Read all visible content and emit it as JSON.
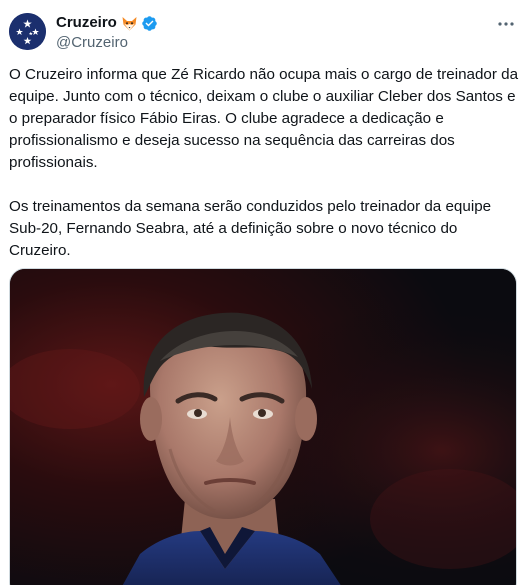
{
  "author": {
    "display_name": "Cruzeiro",
    "handle": "@Cruzeiro",
    "badge_emoji": "fox-emoji",
    "verified_icon": "verified-badge-icon",
    "avatar_icon": "cruzeiro-crest-avatar"
  },
  "menu": {
    "icon": "more-dots-icon"
  },
  "tweet": {
    "paragraph_1": "O Cruzeiro informa que Zé Ricardo não ocupa mais o cargo de treinador da equipe. Junto com o técnico, deixam o clube o auxiliar Cleber dos Santos e o preparador físico Fábio Eiras. O clube agradece a dedicação e profissionalismo e deseja sucesso na sequência das carreiras dos profissionais.",
    "paragraph_2": "Os treinamentos da semana serão conduzidos pelo treinador da equipe Sub-20, Fernando Seabra, até a definição sobre o novo técnico do Cruzeiro."
  },
  "media": {
    "kind": "photo"
  },
  "colors": {
    "brand_blue": "#1b2f6e",
    "verified_blue": "#1d9bf0",
    "text_primary": "#0f1419",
    "text_secondary": "#536471"
  }
}
